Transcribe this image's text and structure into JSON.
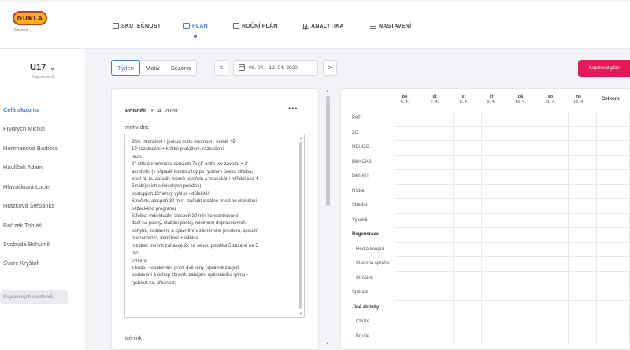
{
  "logo": {
    "text": "DUKLA",
    "sub": "Powered by ..."
  },
  "nav": [
    {
      "label": "SKUTEČNOST",
      "active": false
    },
    {
      "label": "PLÁN",
      "active": true
    },
    {
      "label": "ROČNÍ PLÁN",
      "active": false
    },
    {
      "label": "ANALYTIKA",
      "active": false
    },
    {
      "label": "NASTAVENÍ",
      "active": false
    }
  ],
  "team": {
    "name": "U17",
    "subtitle": "8 sportovců"
  },
  "sidebar": {
    "items": [
      {
        "label": "Celá skupina",
        "active": true
      },
      {
        "label": "Frydrych Michal",
        "active": false
      },
      {
        "label": "Hartmanová Barbora",
        "active": false
      },
      {
        "label": "Havlíček Adam",
        "active": false
      },
      {
        "label": "Hlaváčková Lucie",
        "active": false
      },
      {
        "label": "Hrázková Štěpánka",
        "active": false
      },
      {
        "label": "Pařízek Tobiáš",
        "active": false
      },
      {
        "label": "Svoboda Bohumil",
        "active": false
      },
      {
        "label": "Švarc Kryštof",
        "active": false
      }
    ],
    "excluded_button": "0 vyřazených sportovců"
  },
  "toolbar": {
    "views": [
      {
        "label": "Týden",
        "active": true
      },
      {
        "label": "Motiv",
        "active": false
      },
      {
        "label": "Sezóna",
        "active": false
      }
    ],
    "prev": "<",
    "next": ">",
    "date_range": "06. 04. - 12. 04. 2020",
    "copy_button": "Kopírovat plán"
  },
  "day_panel": {
    "day_name": "Pondělí",
    "date": "6. 4. 2020",
    "more": "•••",
    "motiv_label": "motiv dne",
    "notes": "Běh: intenzivní ! (pokud máte možnost - kombi 45'\n10' rozklusání + krátké protažení, rozcvičení\nkruh:\n2 ' střídání intenzita souvislé 7x (1' ostře vrv závodu + 2'\naerobně; (v případě kombi vždy po rychlém úseku střelba;\npřed hl. m. zařadit: kromě nástřelu a nacvakání mířidel cca 4-\n5 nabíjecích střeleckých položek);\npostupých 10' lehký výklus - důležité!\nStrečink, alespoň 30 min - zařadit ideálně hned po skončení\nběžeckého programu\nStřelba: individuální alespoň 30 min koncentrované,\ndbát na pevný, stabilní postoj, minimum doprovodných\npohybů, zastavení a zpevnění v záměrném prostoru, spoušť\n\"do ramene\", domíření + odhled\nrozstřel: trénink zahajuje 2x za sebou položka 5 zásahů na 5\nran\ncvičení:\nz kroku - opakování první dvě rány (správně zaujetí\npostavení a úchop zbraně, zahájení optimálního rytmu -\nrychlost vs. přesnost;",
    "trenink_label": "trénink"
  },
  "plan_table": {
    "columns": [
      {
        "day": "po",
        "date": "6. 4."
      },
      {
        "day": "út",
        "date": "7. 4."
      },
      {
        "day": "st",
        "date": "8. 4."
      },
      {
        "day": "čt",
        "date": "9. 4."
      },
      {
        "day": "pá",
        "date": "10. 4."
      },
      {
        "day": "so",
        "date": "11. 4."
      },
      {
        "day": "ne",
        "date": "12. 4."
      }
    ],
    "total_label": "Celkem",
    "rows": [
      {
        "label": "PAT",
        "type": "normal"
      },
      {
        "label": "ZO",
        "type": "normal"
      },
      {
        "label": "NEHOC",
        "type": "normal"
      },
      {
        "label": "Běh CAS",
        "type": "normal"
      },
      {
        "label": "Běh KH",
        "type": "normal"
      },
      {
        "label": "Nízká",
        "type": "normal"
      },
      {
        "label": "Střední",
        "type": "normal"
      },
      {
        "label": "Vysoká",
        "type": "normal"
      },
      {
        "label": "Regenerace",
        "type": "bold"
      },
      {
        "label": "Horká koupel",
        "type": "sub"
      },
      {
        "label": "Studená sprcha",
        "type": "sub"
      },
      {
        "label": "Strečink",
        "type": "sub"
      },
      {
        "label": "Spánek",
        "type": "normal"
      },
      {
        "label": "Jiné aktivity",
        "type": "bold"
      },
      {
        "label": "Chůze",
        "type": "sub"
      },
      {
        "label": "Bruslе",
        "type": "sub"
      }
    ]
  },
  "colors": {
    "accent": "#4a7bd6",
    "copy_button": "#e5195a",
    "background": "#f2f3f6"
  }
}
